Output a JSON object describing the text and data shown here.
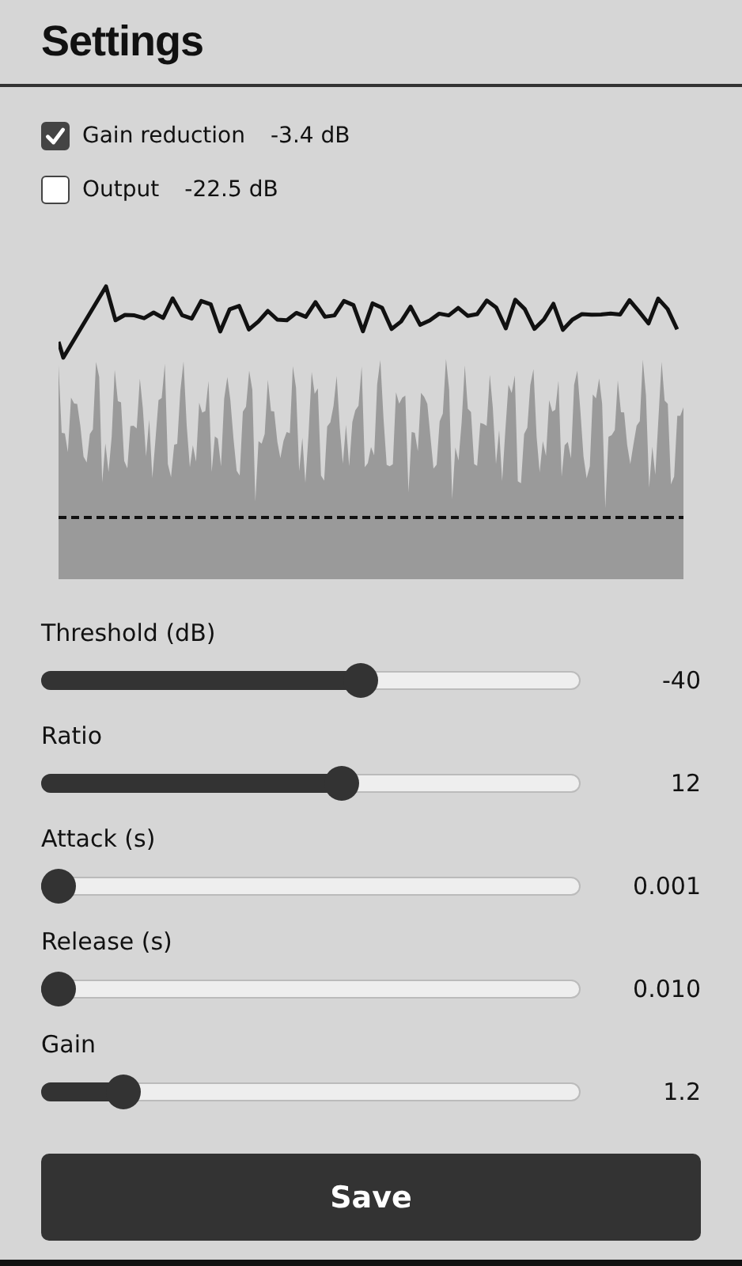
{
  "title": "Settings",
  "toggles": [
    {
      "label": "Gain reduction",
      "reading": "-3.4 dB",
      "checked": true
    },
    {
      "label": "Output",
      "reading": "-22.5 dB",
      "checked": false
    }
  ],
  "sliders": [
    {
      "label": "Threshold (dB)",
      "level": 0.6,
      "reading": "-40"
    },
    {
      "label": "Ratio",
      "level": 0.56,
      "reading": "12"
    },
    {
      "label": "Attack (s)",
      "level": 0,
      "reading": "0.001"
    },
    {
      "label": "Release (s)",
      "level": 0,
      "reading": "0.010"
    },
    {
      "label": "Gain",
      "level": 0.13,
      "reading": "1.2"
    }
  ],
  "save_button": "Save"
}
